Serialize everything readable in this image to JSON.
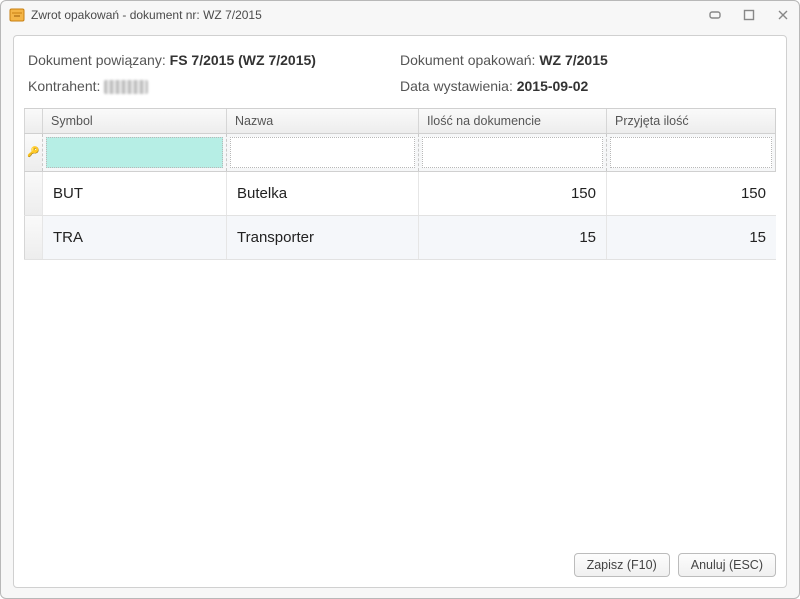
{
  "window": {
    "title": "Zwrot opakowań - dokument nr: WZ 7/2015"
  },
  "header": {
    "linked_label": "Dokument powiązany:",
    "linked_value": "FS 7/2015 (WZ 7/2015)",
    "pack_label": "Dokument opakowań:",
    "pack_value": "WZ 7/2015",
    "kontrahent_label": "Kontrahent:",
    "date_label": "Data wystawienia:",
    "date_value": "2015-09-02"
  },
  "grid": {
    "columns": {
      "symbol": "Symbol",
      "nazwa": "Nazwa",
      "ilosc": "Ilość na dokumencie",
      "przyjeta": "Przyjęta ilość"
    },
    "rows": [
      {
        "symbol": "BUT",
        "nazwa": "Butelka",
        "ilosc": "150",
        "przyjeta": "150"
      },
      {
        "symbol": "TRA",
        "nazwa": "Transporter",
        "ilosc": "15",
        "przyjeta": "15"
      }
    ]
  },
  "footer": {
    "save": "Zapisz (F10)",
    "cancel": "Anuluj (ESC)"
  }
}
